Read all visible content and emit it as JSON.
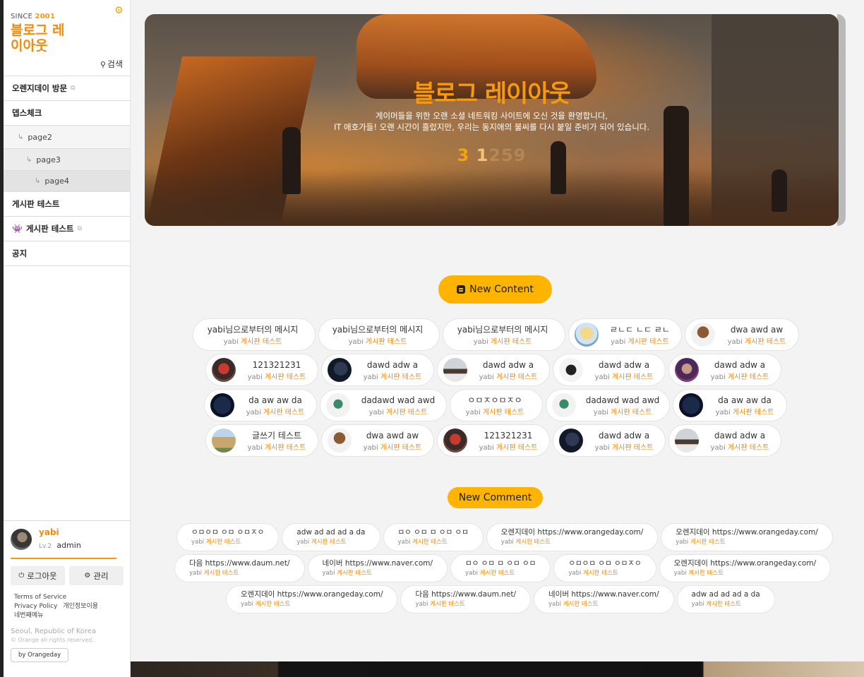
{
  "sidebar": {
    "since_label": "SINCE",
    "since_year": "2001",
    "logo_title": "블로그 레이아웃",
    "search_label": "검색",
    "menu": [
      {
        "label": "오렌지데이 방문",
        "external": true
      },
      {
        "label": "뎁스체크"
      },
      {
        "label": "page2",
        "level": 1
      },
      {
        "label": "page3",
        "level": 2
      },
      {
        "label": "page4",
        "level": 3
      },
      {
        "label": "게시판 테스트"
      },
      {
        "label": "게시판 테스트",
        "external": true,
        "icon": "space-invader-icon"
      },
      {
        "label": "공지"
      }
    ]
  },
  "profile": {
    "name": "yabi",
    "level": "Lv.2",
    "role": "admin",
    "logout_label": "로그아웃",
    "manage_label": "관리",
    "links": [
      "Terms of Service",
      "Privacy Policy",
      "개인정보이용",
      "네번째메뉴"
    ],
    "address": "Seoul, Republic of Korea",
    "copyright": "© Orange all rights reserved.",
    "by_label": "by Orangeday"
  },
  "hero": {
    "title": "블로그 레이아웃",
    "subtitle_line1": "게이머들을 위한 오랜 소셜 네트워킹 사이트에 오신 것을 환영합니다,",
    "subtitle_line2": "IT 애호가들! 오랜 시간이 흘렀지만, 우리는 동지애의 불씨를 다시 붙일 준비가 되어 있습니다.",
    "count_a": "3",
    "count_b": "1",
    "count_c": "259"
  },
  "new_content": {
    "heading": "New Content",
    "rows": [
      [
        {
          "title": "yabi님으로부터의 메시지",
          "author": "yabi",
          "board": "게시판 테스트",
          "thumb": "none"
        },
        {
          "title": "yabi님으로부터의 메시지",
          "author": "yabi",
          "board": "게시판 테스트",
          "thumb": "none"
        },
        {
          "title": "yabi님으로부터의 메시지",
          "author": "yabi",
          "board": "게시판 테스트",
          "thumb": "none"
        },
        {
          "title": "ㄹㄴㄷ ㄴㄷ ㄹㄴ",
          "author": "yabi",
          "board": "게시판 테스트",
          "thumb": "anime"
        },
        {
          "title": "dwa awd aw",
          "author": "yabi",
          "board": "게시판 테스트",
          "thumb": "figure"
        }
      ],
      [
        {
          "title": "121321231",
          "author": "yabi",
          "board": "게시판 테스트",
          "thumb": "hero"
        },
        {
          "title": "dawd adw a",
          "author": "yabi",
          "board": "게시판 테스트",
          "thumb": "dark"
        },
        {
          "title": "dawd adw a",
          "author": "yabi",
          "board": "게시판 테스트",
          "thumb": "snow"
        },
        {
          "title": "dawd adw a",
          "author": "yabi",
          "board": "게시판 테스트",
          "thumb": "witch"
        },
        {
          "title": "dawd adw a",
          "author": "yabi",
          "board": "게시판 테스트",
          "thumb": "portrait"
        }
      ],
      [
        {
          "title": "da aw aw da",
          "author": "yabi",
          "board": "게시판 테스트",
          "thumb": "night"
        },
        {
          "title": "dadawd wad awd",
          "author": "yabi",
          "board": "게시판 테스트",
          "thumb": "plant"
        },
        {
          "title": "ㅇㅁㅈㅇㅁㅈㅇ",
          "author": "yabi",
          "board": "게시판 테스트",
          "thumb": "none"
        },
        {
          "title": "dadawd wad awd",
          "author": "yabi",
          "board": "게시판 테스트",
          "thumb": "plant"
        },
        {
          "title": "da aw aw da",
          "author": "yabi",
          "board": "게시판 테스트",
          "thumb": "night"
        }
      ],
      [
        {
          "title": "글쓰기 테스트",
          "author": "yabi",
          "board": "게시판 테스트",
          "thumb": "building"
        },
        {
          "title": "dwa awd aw",
          "author": "yabi",
          "board": "게시판 테스트",
          "thumb": "figure"
        },
        {
          "title": "121321231",
          "author": "yabi",
          "board": "게시판 테스트",
          "thumb": "hero"
        },
        {
          "title": "dawd adw a",
          "author": "yabi",
          "board": "게시판 테스트",
          "thumb": "dark"
        },
        {
          "title": "dawd adw a",
          "author": "yabi",
          "board": "게시판 테스트",
          "thumb": "snow"
        }
      ]
    ]
  },
  "new_comment": {
    "heading": "New Comment",
    "rows": [
      [
        {
          "text": "ㅇㅁㅇㅁ ㅇㅁ ㅇㅁㅈㅇ",
          "author": "yabi",
          "board": "게시판 테스트"
        },
        {
          "text": "adw ad ad ad a da",
          "author": "yabi",
          "board": "게시판 테스트"
        },
        {
          "text": "ㅁㅇ ㅇㅁ ㅁ ㅇㅁ ㅇㅁ",
          "author": "yabi",
          "board": "게시판 테스트"
        },
        {
          "text": "오렌지데이 https://www.orangeday.com/",
          "author": "yabi",
          "board": "게시판 테스트"
        },
        {
          "text": "오렌지데이 https://www.orangeday.com/",
          "author": "yabi",
          "board": "게시판 테스트"
        }
      ],
      [
        {
          "text": "다음 https://www.daum.net/",
          "author": "yabi",
          "board": "게시판 테스트"
        },
        {
          "text": "네이버 https://www.naver.com/",
          "author": "yabi",
          "board": "게시판 테스트"
        },
        {
          "text": "ㅁㅇ ㅇㅁ ㅁ ㅇㅁ ㅇㅁ",
          "author": "yabi",
          "board": "게시판 테스트"
        },
        {
          "text": "ㅇㅁㅇㅁ ㅇㅁ ㅇㅁㅈㅇ",
          "author": "yabi",
          "board": "게시판 테스트"
        },
        {
          "text": "오렌지데이 https://www.orangeday.com/",
          "author": "yabi",
          "board": "게시판 테스트"
        }
      ],
      [
        {
          "text": "오렌지데이 https://www.orangeday.com/",
          "author": "yabi",
          "board": "게시판 테스트"
        },
        {
          "text": "다음 https://www.daum.net/",
          "author": "yabi",
          "board": "게시판 테스트"
        },
        {
          "text": "네이버 https://www.naver.com/",
          "author": "yabi",
          "board": "게시판 테스트"
        },
        {
          "text": "adw ad ad ad a da",
          "author": "yabi",
          "board": "게시판 테스트"
        }
      ]
    ]
  },
  "colors": {
    "accent": "#f28a0a",
    "pill": "#ffb400"
  }
}
